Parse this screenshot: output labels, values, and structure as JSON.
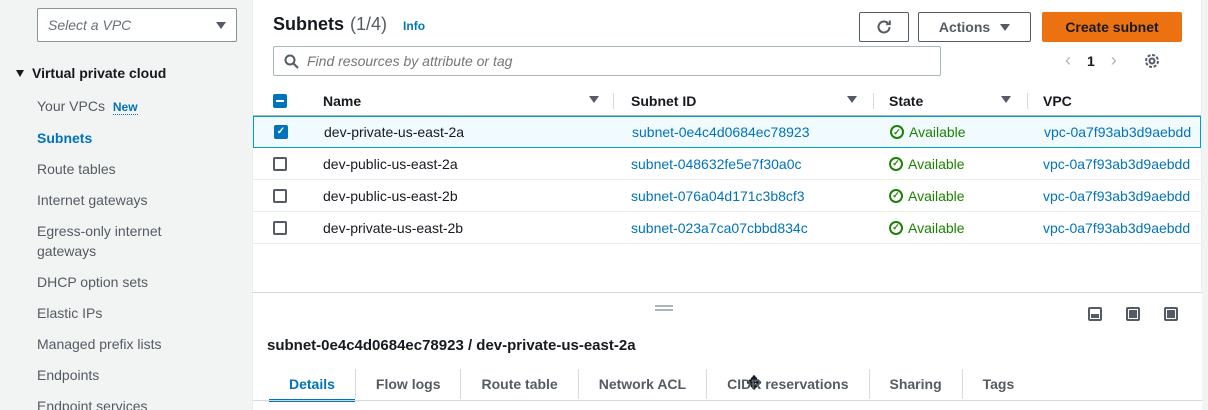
{
  "sidebar": {
    "vpc_filter_placeholder": "Select a VPC",
    "section_title": "Virtual private cloud",
    "items": [
      {
        "label": "Your VPCs",
        "badge": "New"
      },
      {
        "label": "Subnets",
        "active": true
      },
      {
        "label": "Route tables"
      },
      {
        "label": "Internet gateways"
      },
      {
        "label": "Egress-only internet gateways"
      },
      {
        "label": "DHCP option sets"
      },
      {
        "label": "Elastic IPs"
      },
      {
        "label": "Managed prefix lists"
      },
      {
        "label": "Endpoints"
      },
      {
        "label": "Endpoint services"
      }
    ]
  },
  "header": {
    "title": "Subnets",
    "count": "(1/4)",
    "info": "Info",
    "refresh_icon": "refresh-icon",
    "actions_label": "Actions",
    "create_label": "Create subnet"
  },
  "search": {
    "placeholder": "Find resources by attribute or tag"
  },
  "pagination": {
    "prev": "‹",
    "page": "1",
    "next": "›"
  },
  "table": {
    "columns": [
      "Name",
      "Subnet ID",
      "State",
      "VPC"
    ],
    "rows": [
      {
        "name": "dev-private-us-east-2a",
        "subnet_id": "subnet-0e4c4d0684ec78923",
        "state": "Available",
        "vpc": "vpc-0a7f93ab3d9aebdd",
        "selected": true
      },
      {
        "name": "dev-public-us-east-2a",
        "subnet_id": "subnet-048632fe5e7f30a0c",
        "state": "Available",
        "vpc": "vpc-0a7f93ab3d9aebdd",
        "selected": false
      },
      {
        "name": "dev-public-us-east-2b",
        "subnet_id": "subnet-076a04d171c3b8cf3",
        "state": "Available",
        "vpc": "vpc-0a7f93ab3d9aebdd",
        "selected": false
      },
      {
        "name": "dev-private-us-east-2b",
        "subnet_id": "subnet-023a7ca07cbbd834c",
        "state": "Available",
        "vpc": "vpc-0a7f93ab3d9aebdd",
        "selected": false
      }
    ]
  },
  "detail": {
    "title": "subnet-0e4c4d0684ec78923 / dev-private-us-east-2a",
    "tabs": [
      "Details",
      "Flow logs",
      "Route table",
      "Network ACL",
      "CIDR reservations",
      "Sharing",
      "Tags"
    ],
    "active_tab": "Details"
  },
  "colors": {
    "accent": "#0073bb",
    "primary_button": "#ec7211",
    "status_ok": "#1d8102"
  }
}
